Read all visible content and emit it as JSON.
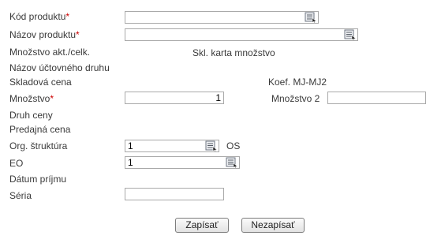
{
  "fields": {
    "kod_produktu": {
      "label": "Kód produktu",
      "required": "*",
      "value": ""
    },
    "nazov_produktu": {
      "label": "Názov produktu",
      "required": "*",
      "value": ""
    },
    "mnozstvo_akt": {
      "label": "Množstvo akt./celk.",
      "info": "Skl. karta množstvo"
    },
    "nazov_uctovneho_druhu": {
      "label": "Názov účtovného druhu"
    },
    "skladova_cena": {
      "label": "Skladová cena",
      "info": "Koef. MJ-MJ2"
    },
    "mnozstvo": {
      "label": "Množstvo",
      "required": "*",
      "value": "1"
    },
    "mnozstvo2": {
      "label": "Množstvo 2",
      "value": ""
    },
    "druh_ceny": {
      "label": "Druh ceny"
    },
    "predajna_cena": {
      "label": "Predajná cena"
    },
    "org_struktura": {
      "label": "Org. štruktúra",
      "value": "1",
      "suffix": "OS"
    },
    "eo": {
      "label": "EO",
      "value": "1"
    },
    "datum_prijmu": {
      "label": "Dátum príjmu"
    },
    "seria": {
      "label": "Séria",
      "value": ""
    }
  },
  "buttons": {
    "save": "Zapísať",
    "cancel": "Nezapísať"
  },
  "icons": {
    "picker": "list-picker-icon"
  }
}
